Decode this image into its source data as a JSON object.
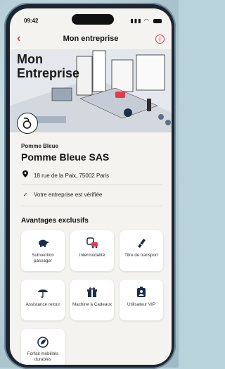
{
  "status": {
    "time": "09:42"
  },
  "nav": {
    "title": "Mon entreprise"
  },
  "hero": {
    "title_line1": "Mon",
    "title_line2": "Entreprise"
  },
  "company": {
    "short_name": "Pomme Bleue",
    "full_name": "Pomme Bleue SAS",
    "address": "18 rue de la Paix, 75002 Paris",
    "verified_text": "Votre entreprise est vérifiée"
  },
  "benefits": {
    "heading": "Avantages exclusifs",
    "items": [
      {
        "label": "Subvention passager",
        "icon": "piggy-bank-icon"
      },
      {
        "label": "Intermodalité",
        "icon": "transit-icon"
      },
      {
        "label": "Titre de transport",
        "icon": "ticket-icon"
      },
      {
        "label": "Assistance retour",
        "icon": "umbrella-icon"
      },
      {
        "label": "Machine à Cadeaux",
        "icon": "gift-icon"
      },
      {
        "label": "Utilisateur VIP",
        "icon": "vip-badge-icon"
      },
      {
        "label": "Forfait mobilités durables",
        "icon": "leaf-cycle-icon"
      }
    ]
  },
  "colors": {
    "accent": "#e63a4a",
    "icon_dark": "#1c2d4a",
    "background": "#f4f3ef"
  }
}
